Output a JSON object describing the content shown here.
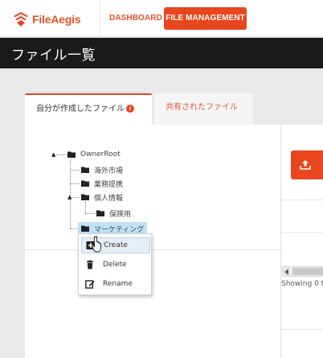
{
  "app": {
    "logo_text": "FileAegis",
    "brand_color": "#e8461d"
  },
  "nav": {
    "dashboard_label": "DASHBOARD",
    "file_management_label": "FILE MANAGEMENT"
  },
  "page": {
    "title": "ファイル一覧"
  },
  "tabs": [
    {
      "label": "自分が作成したファイル",
      "active": true,
      "badge_icon": "info-icon",
      "badge_text": "i"
    },
    {
      "label": "共有されたファイル",
      "active": false
    }
  ],
  "tree": {
    "root": {
      "label": "OwnerRoot",
      "icon": "folder-icon"
    },
    "children": [
      {
        "label": "海外市場",
        "icon": "folder-icon"
      },
      {
        "label": "業務提携",
        "icon": "folder-icon"
      },
      {
        "label": "個人情報",
        "icon": "folder-icon",
        "children": [
          {
            "label": "保険用",
            "icon": "folder-icon"
          }
        ]
      },
      {
        "label": "マーケティング",
        "icon": "folder-icon",
        "selected": true
      }
    ]
  },
  "context_menu": {
    "items": [
      {
        "label": "Create",
        "icon": "add-folder-icon"
      },
      {
        "label": "Delete",
        "icon": "trash-icon"
      },
      {
        "label": "Rename",
        "icon": "edit-icon"
      }
    ]
  },
  "right_panel": {
    "upload_icon": "upload-icon",
    "showing_text": "Showing 0 t"
  }
}
